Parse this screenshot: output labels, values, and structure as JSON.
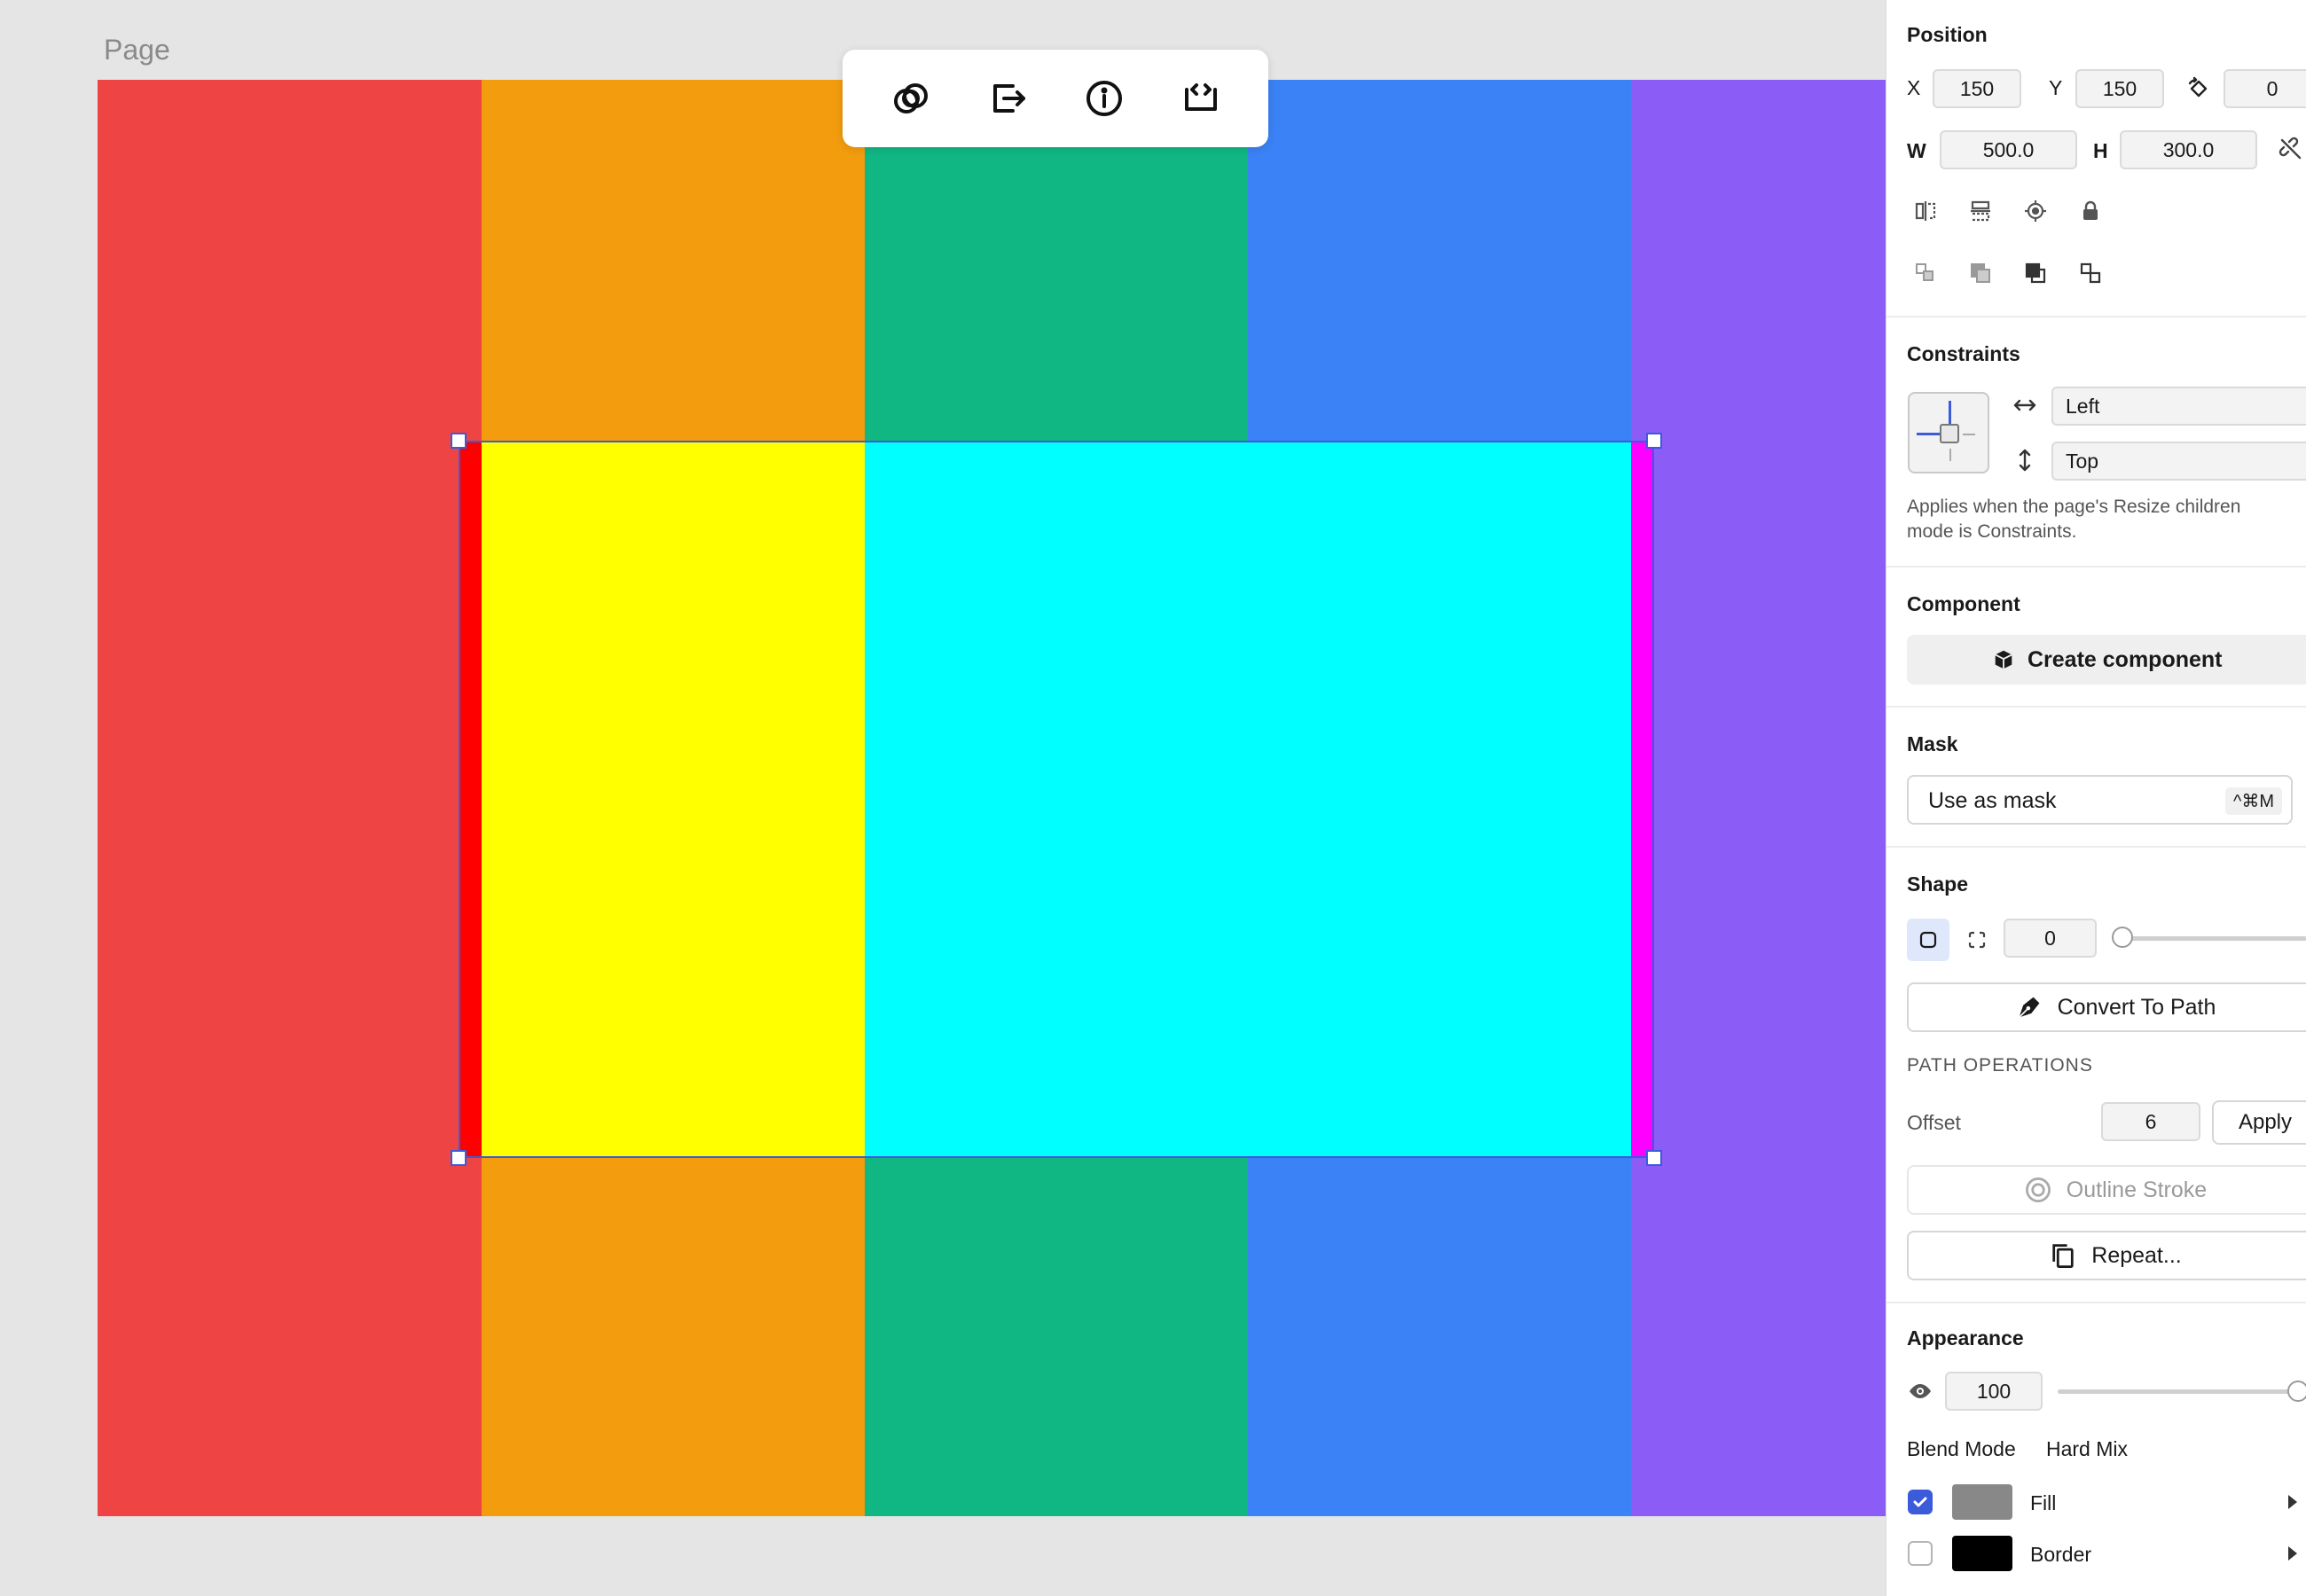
{
  "canvas": {
    "page_label": "Page",
    "background_stripes": [
      {
        "name": "red",
        "color": "#ef4444"
      },
      {
        "name": "orange",
        "color": "#f39c0e"
      },
      {
        "name": "green",
        "color": "#10b782"
      },
      {
        "name": "blue",
        "color": "#3b82f6"
      },
      {
        "name": "purple",
        "color": "#8b5cf6"
      }
    ],
    "masked_result_colors": [
      "#ff0000",
      "#ffff00",
      "#00ffff",
      "#ff00ff"
    ],
    "selection_color": "#3b5bdb"
  },
  "floating_toolbar": {
    "icons": [
      "boolean-icon",
      "export-icon",
      "info-icon",
      "code-icon"
    ]
  },
  "panel": {
    "position": {
      "title": "Position",
      "x_label": "X",
      "x_value": "150",
      "y_label": "Y",
      "y_value": "150",
      "rotation_value": "0",
      "w_label": "W",
      "w_value": "500.0",
      "h_label": "H",
      "h_value": "300.0"
    },
    "constraints": {
      "title": "Constraints",
      "horizontal": "Left",
      "vertical": "Top",
      "note": "Applies when the page's Resize children mode is Constraints."
    },
    "component": {
      "title": "Component",
      "button": "Create component"
    },
    "mask": {
      "title": "Mask",
      "button": "Use as mask",
      "shortcut": "^⌘M"
    },
    "shape": {
      "title": "Shape",
      "radius_value": "0",
      "convert_button": "Convert To Path",
      "path_ops_title": "PATH OPERATIONS",
      "offset_label": "Offset",
      "offset_value": "6",
      "apply_button": "Apply",
      "outline_button": "Outline Stroke",
      "repeat_button": "Repeat..."
    },
    "appearance": {
      "title": "Appearance",
      "opacity_value": "100",
      "blend_label": "Blend Mode",
      "blend_value": "Hard Mix",
      "fill_label": "Fill",
      "fill_color": "#888888",
      "fill_checked": true,
      "border_label": "Border",
      "border_color": "#000000",
      "border_checked": false
    }
  }
}
